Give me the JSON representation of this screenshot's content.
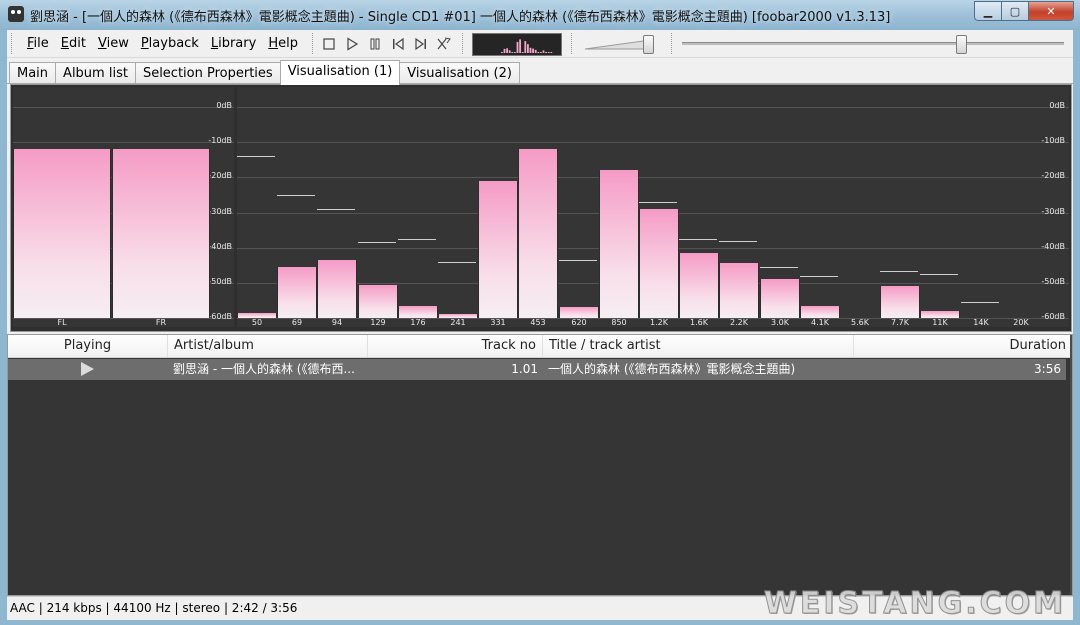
{
  "window": {
    "title": "劉思涵 - [一個人的森林 (《德布西森林》電影概念主題曲) - Single CD1 #01] 一個人的森林 (《德布西森林》電影概念主題曲)  [foobar2000 v1.3.13]",
    "min_glyph": "▁",
    "max_glyph": "▢",
    "close_glyph": "✕"
  },
  "menu": [
    "File",
    "Edit",
    "View",
    "Playback",
    "Library",
    "Help"
  ],
  "toolbar": {
    "buttons": [
      "stop-icon",
      "play-icon",
      "pause-icon",
      "previous-icon",
      "next-icon",
      "random-icon"
    ],
    "volume_level": 0.88,
    "seek_position": 0.74
  },
  "tabs": [
    {
      "label": "Main",
      "active": false
    },
    {
      "label": "Album list",
      "active": false
    },
    {
      "label": "Selection Properties",
      "active": false
    },
    {
      "label": "Visualisation (1)",
      "active": true
    },
    {
      "label": "Visualisation (2)",
      "active": false
    }
  ],
  "visualisation": {
    "db_labels": [
      "0dB",
      "-10dB",
      "-20dB",
      "-30dB",
      "-40dB",
      "-50dB",
      "-60dB"
    ],
    "vu": [
      {
        "channel": "FL",
        "level_db": -12
      },
      {
        "channel": "FR",
        "level_db": -12
      }
    ],
    "spectrum": [
      {
        "freq": "50",
        "level_db": -58.5,
        "peak_db": -14
      },
      {
        "freq": "69",
        "level_db": -45.5,
        "peak_db": -25
      },
      {
        "freq": "94",
        "level_db": -43.5,
        "peak_db": -29
      },
      {
        "freq": "129",
        "level_db": -50.5,
        "peak_db": -38.5
      },
      {
        "freq": "176",
        "level_db": -56.5,
        "peak_db": -37.5
      },
      {
        "freq": "241",
        "level_db": -59,
        "peak_db": -44
      },
      {
        "freq": "331",
        "level_db": -21,
        "peak_db": null
      },
      {
        "freq": "453",
        "level_db": -12,
        "peak_db": null
      },
      {
        "freq": "620",
        "level_db": -57,
        "peak_db": -43.5
      },
      {
        "freq": "850",
        "level_db": -18,
        "peak_db": null
      },
      {
        "freq": "1.2K",
        "level_db": -29,
        "peak_db": -27
      },
      {
        "freq": "1.6K",
        "level_db": -41.5,
        "peak_db": -37.5
      },
      {
        "freq": "2.2K",
        "level_db": -44.5,
        "peak_db": -38
      },
      {
        "freq": "3.0K",
        "level_db": -49,
        "peak_db": -45.5
      },
      {
        "freq": "4.1K",
        "level_db": -56.5,
        "peak_db": -48
      },
      {
        "freq": "5.6K",
        "level_db": -60,
        "peak_db": null
      },
      {
        "freq": "7.7K",
        "level_db": -51,
        "peak_db": -46.5
      },
      {
        "freq": "11K",
        "level_db": -58,
        "peak_db": -47.5
      },
      {
        "freq": "14K",
        "level_db": -60,
        "peak_db": -55.5
      },
      {
        "freq": "20K",
        "level_db": -60,
        "peak_db": null
      }
    ]
  },
  "playlist": {
    "columns": [
      "Playing",
      "Artist/album",
      "Track no",
      "Title / track artist",
      "Duration"
    ],
    "rows": [
      {
        "artist_album": "劉思涵 - 一個人的森林 (《德布西...",
        "track_no": "1.01",
        "title": "一個人的森林 (《德布西森林》電影概念主題曲)",
        "duration": "3:56"
      }
    ]
  },
  "status": "AAC | 214 kbps | 44100 Hz | stereo | 2:42 / 3:56",
  "watermark": "WEISTANG.COM"
}
